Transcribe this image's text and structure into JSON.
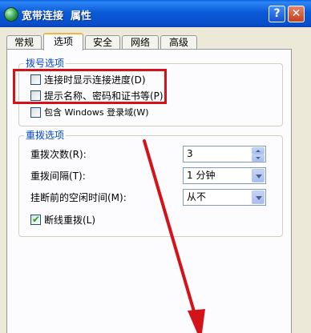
{
  "window": {
    "title": "宽带连接  属性",
    "help_glyph": "?",
    "close_glyph": "✕"
  },
  "tabs": [
    {
      "label": "常规",
      "active": false
    },
    {
      "label": "选项",
      "active": true
    },
    {
      "label": "安全",
      "active": false
    },
    {
      "label": "网络",
      "active": false
    },
    {
      "label": "高级",
      "active": false
    }
  ],
  "dial_options": {
    "title": "拨号选项",
    "items": [
      {
        "label": "连接时显示连接进度(D)",
        "checked": false
      },
      {
        "label": "提示名称、密码和证书等(P)",
        "checked": false
      },
      {
        "label": "包含 Windows 登录域(W)",
        "checked": false
      }
    ]
  },
  "redial_options": {
    "title": "重拨选项",
    "redial_attempts": {
      "label": "重拨次数(R):",
      "value": "3"
    },
    "redial_interval": {
      "label": "重拨间隔(T):",
      "value": "1 分钟"
    },
    "idle_time": {
      "label": "挂断前的空闲时间(M):",
      "value": "从不"
    },
    "redial_if_dropped": {
      "label": "断线重拨(L)",
      "checked": true
    }
  },
  "colors": {
    "highlight_box": "#d4121a",
    "annotation_arrow": "#d4121a",
    "group_title": "#0046d5",
    "titlebar": "#0b5ad8"
  },
  "icons": {
    "window_icon": "network-connection-icon",
    "checkmark": "✔"
  }
}
